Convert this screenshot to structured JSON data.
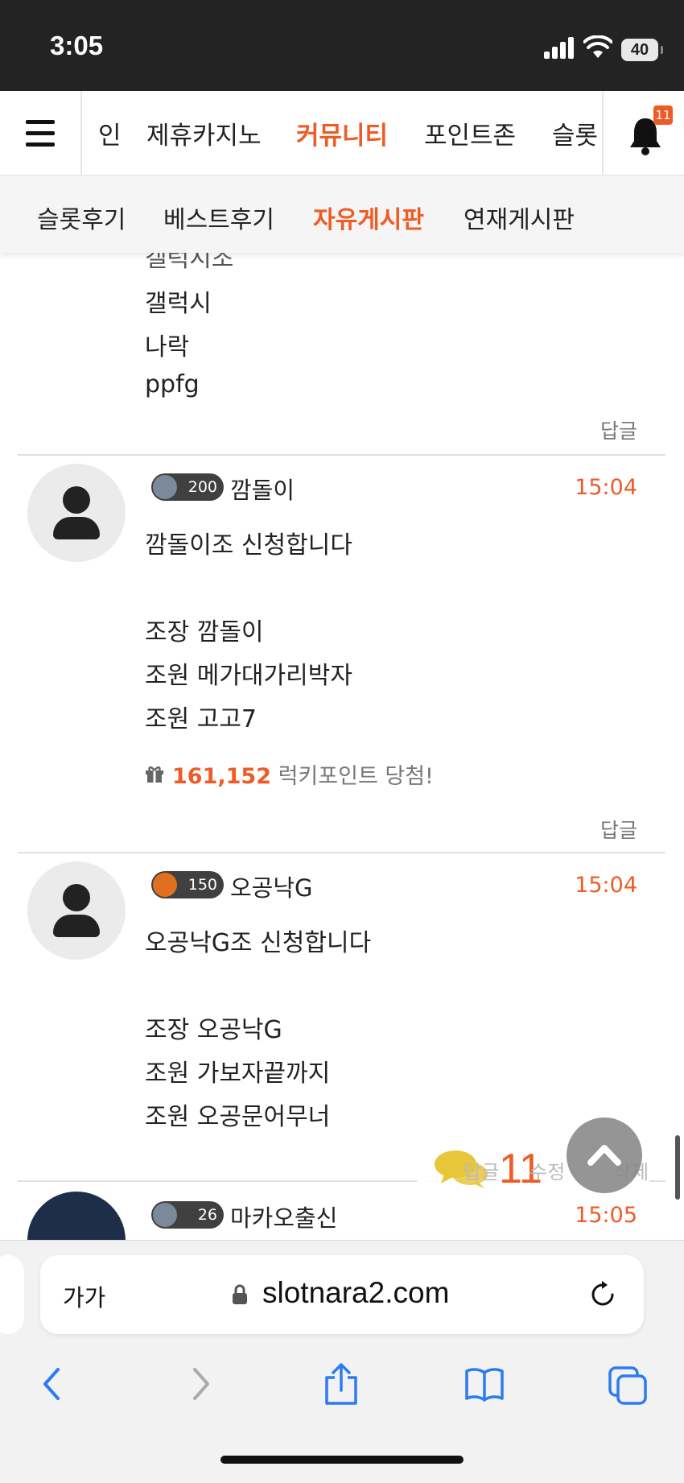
{
  "status": {
    "time": "3:05",
    "battery": "40"
  },
  "nav": {
    "tabs": [
      "인",
      "제휴카지노",
      "커뮤니티",
      "포인트존",
      "슬롯"
    ],
    "active": "커뮤니티",
    "bell_badge": "11"
  },
  "subnav": {
    "tabs": [
      "슬롯후기",
      "베스트후기",
      "자유게시판",
      "연재게시판"
    ],
    "active": "자유게시판"
  },
  "comments": [
    {
      "lines": [
        "갤럭시조",
        "갤럭시",
        "나락",
        " ppfg"
      ],
      "reply": "답글"
    },
    {
      "level": "200",
      "nickname": "깜돌이",
      "time": "15:04",
      "lines": [
        "깜돌이조 신청합니다",
        "",
        "조장 깜돌이",
        "조원 메가대가리박자",
        "조원 고고7"
      ],
      "lucky_amount": "161,152",
      "lucky_text": "럭키포인트 당첨!",
      "reply": "답글"
    },
    {
      "level": "150",
      "nickname": "오공낙G",
      "time": "15:04",
      "lines": [
        "오공낙G조 신청합니다",
        "",
        "조장 오공낙G",
        "조원 가보자끝까지",
        "조원 오공문어무너"
      ],
      "actions": [
        "답글",
        "수정",
        "삭제"
      ],
      "comment_count": "11"
    },
    {
      "level": "26",
      "nickname": "마카오출신",
      "time": "15:05"
    }
  ],
  "browser": {
    "text_size": "가가",
    "url": "slotnara2.com"
  },
  "icons": {
    "menu": "hamburger-icon",
    "bell": "bell-icon",
    "gift": "gift-icon",
    "comments": "speech-bubbles-icon",
    "scroll_top": "chevron-up-icon",
    "back": "chevron-left-icon",
    "forward": "chevron-right-icon",
    "share": "share-icon",
    "bookmarks": "book-icon",
    "tabs": "tabs-icon",
    "reload": "reload-icon",
    "lock": "lock-icon"
  },
  "colors": {
    "accent": "#ef5b25"
  }
}
